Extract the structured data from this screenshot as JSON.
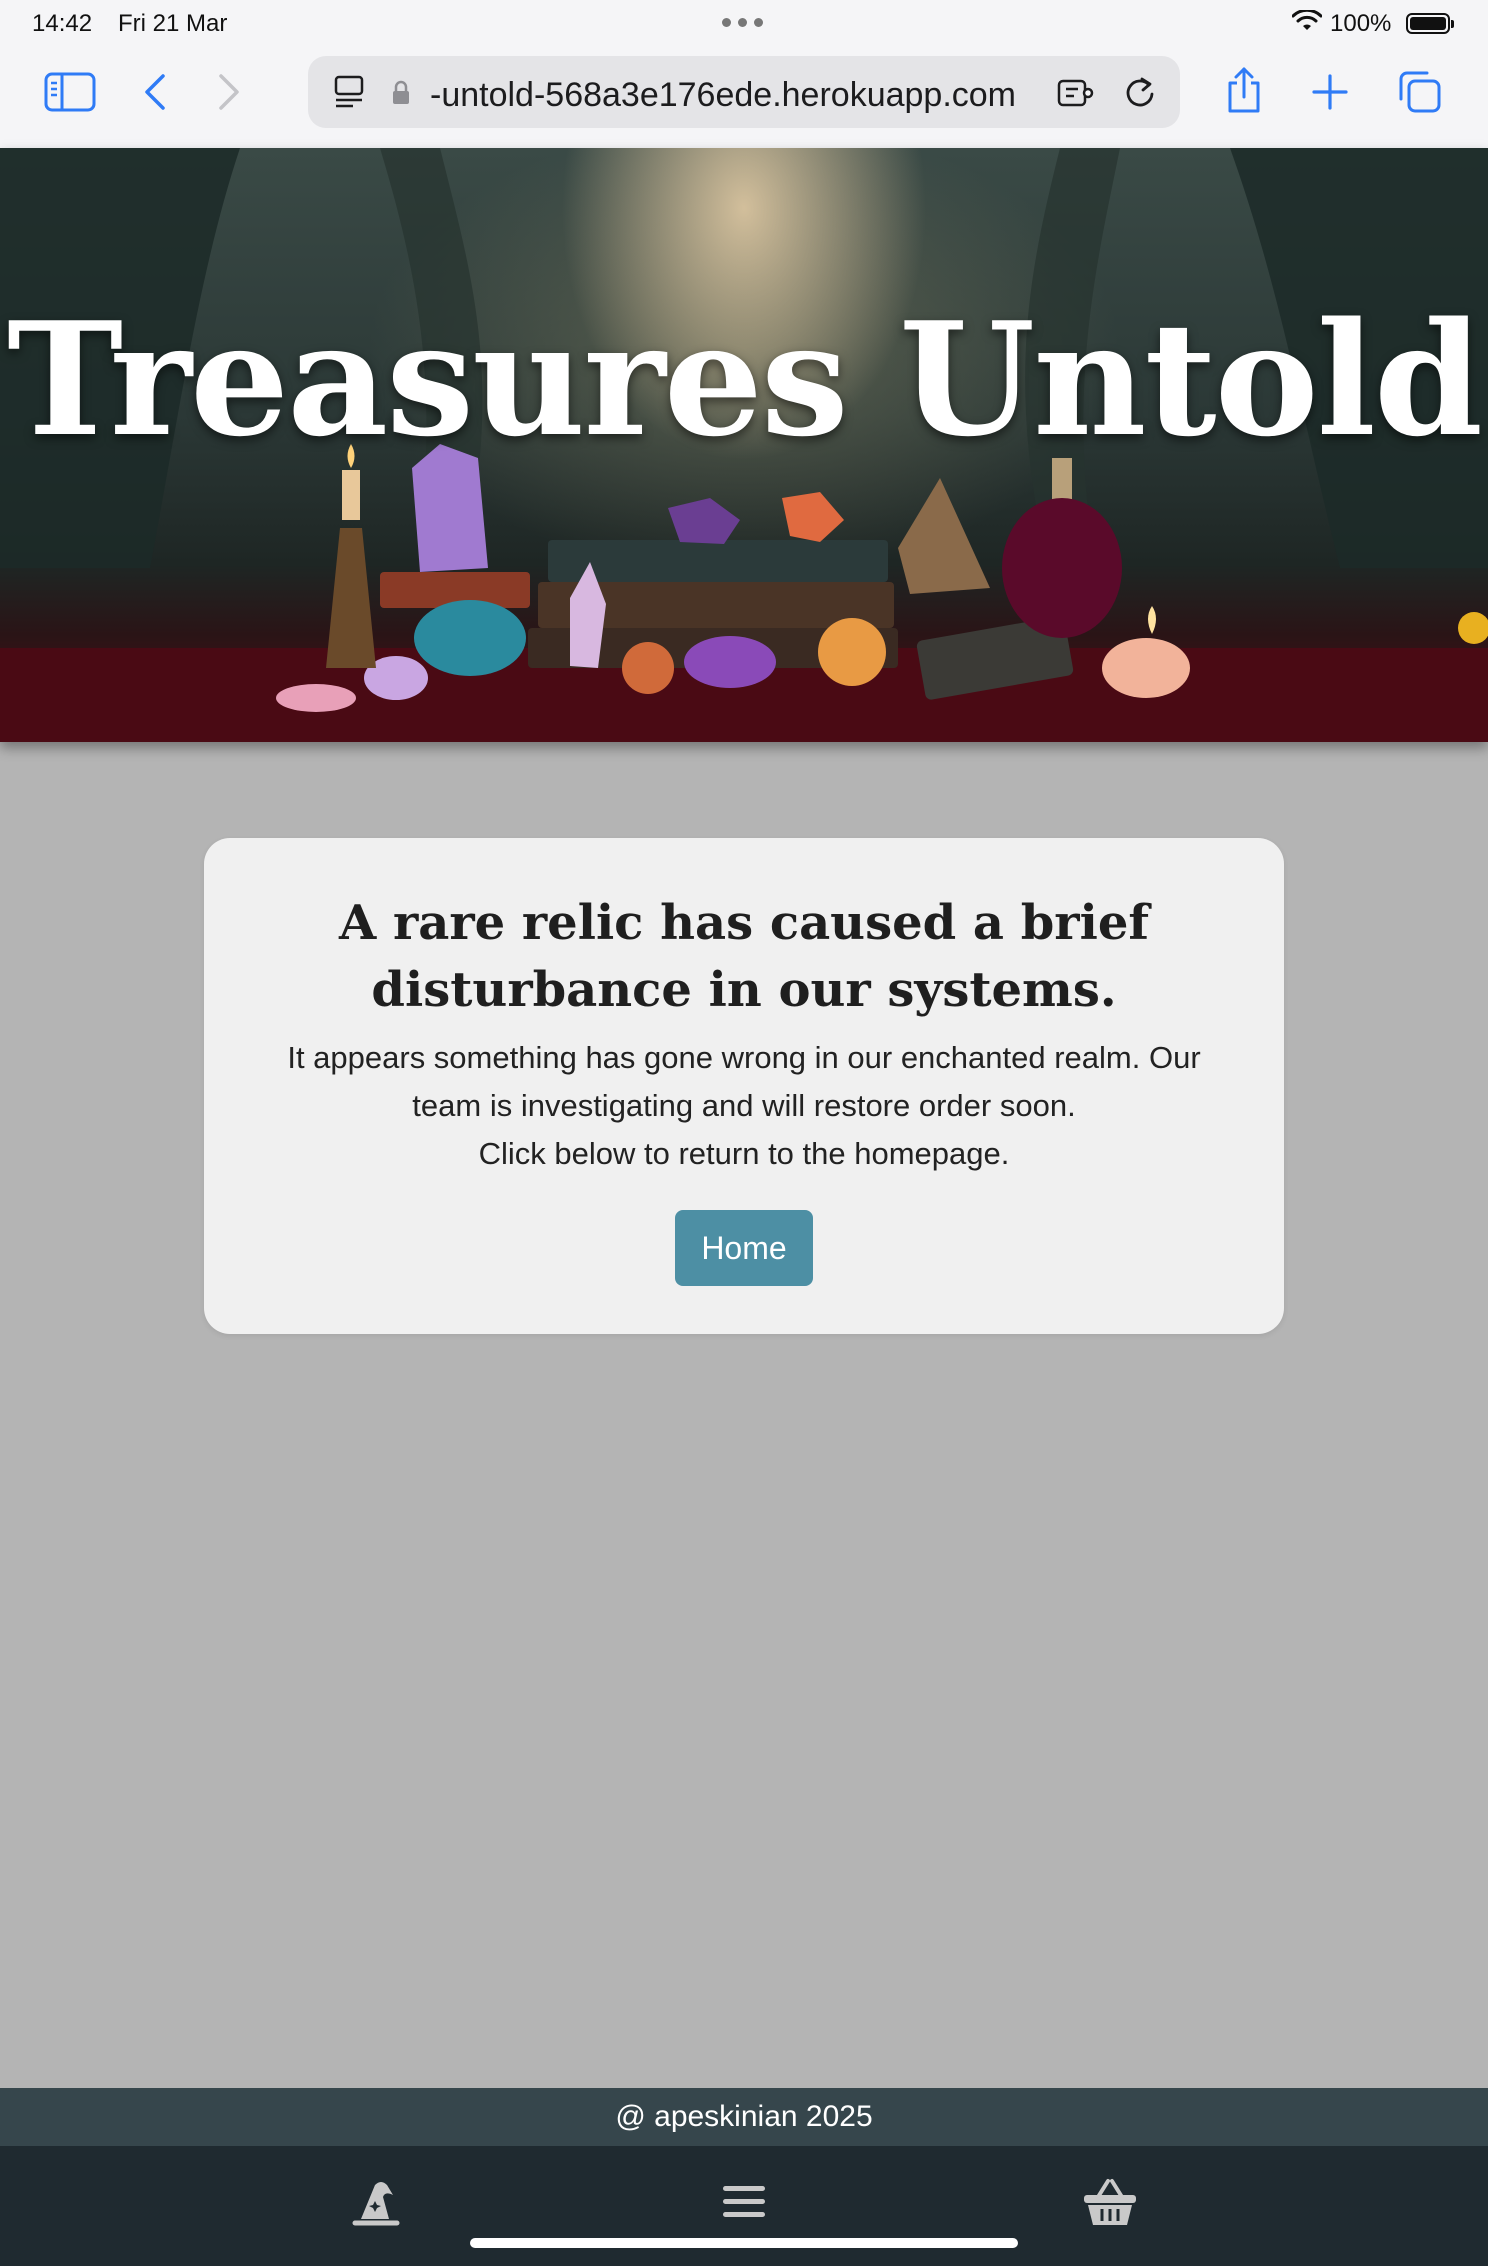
{
  "status_bar": {
    "time": "14:42",
    "date": "Fri 21 Mar",
    "battery": "100%"
  },
  "browser": {
    "url": "-untold-568a3e176ede.herokuapp.com",
    "icons": [
      "sidebar-icon",
      "back-icon",
      "forward-icon",
      "page-menu-icon",
      "lock-icon",
      "extension-icon",
      "reload-icon",
      "share-icon",
      "new-tab-icon",
      "tabs-icon"
    ]
  },
  "hero": {
    "title": "Treasures Untold"
  },
  "error_card": {
    "heading": "A rare relic has caused a brief disturbance in our systems.",
    "message_line1": "It appears something has gone wrong in our enchanted realm. Our team is investigating and will restore order soon.",
    "message_line2": "Click below to return to the homepage.",
    "button_label": "Home",
    "button_color": "#4d8fa4"
  },
  "footer": {
    "text": "@ apeskinian 2025"
  },
  "bottom_nav": {
    "items": [
      "wizard-hat-icon",
      "menu-icon",
      "basket-icon"
    ]
  },
  "colors": {
    "page_background": "#b4b4b4",
    "footer_background": "#36464c",
    "nav_background": "#1f2a30",
    "accent": "#2f7bf6"
  }
}
